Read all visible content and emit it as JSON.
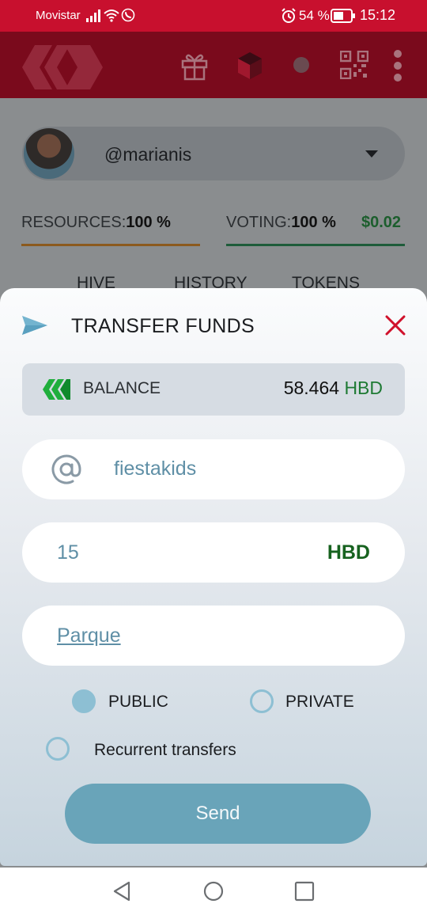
{
  "status_bar": {
    "carrier": "Movistar",
    "battery_percent": "54 %",
    "time": "15:12",
    "icons": [
      "signal-icon",
      "wifi-icon",
      "whatsapp-icon",
      "alarm-icon",
      "battery-icon"
    ]
  },
  "app_bar": {
    "icons": [
      "hive-logo",
      "gift-icon",
      "cube-icon",
      "dot-icon",
      "qr-code-icon",
      "more-vert-icon"
    ]
  },
  "account": {
    "username": "@marianis"
  },
  "resources": {
    "label": "RESOURCES:",
    "value": "100 %"
  },
  "voting": {
    "label": "VOTING:",
    "value": "100 %",
    "usd": "$0.02"
  },
  "tabs": [
    "HIVE",
    "HISTORY",
    "TOKENS"
  ],
  "transfer_modal": {
    "title": "TRANSFER FUNDS",
    "balance_label": "BALANCE",
    "balance_value": "58.464",
    "balance_currency": "HBD",
    "recipient": "fiestakids",
    "amount": "15",
    "currency": "HBD",
    "memo": "Parque",
    "visibility_options": {
      "public": "PUBLIC",
      "private": "PRIVATE"
    },
    "selected_visibility": "public",
    "recurrent_label": "Recurrent transfers",
    "recurrent_checked": false,
    "send_label": "Send"
  },
  "colors": {
    "status_bar": "#c8102e",
    "accent": "#69a4b9",
    "hbd_green": "#1e7a34",
    "close_red": "#d0112b"
  }
}
